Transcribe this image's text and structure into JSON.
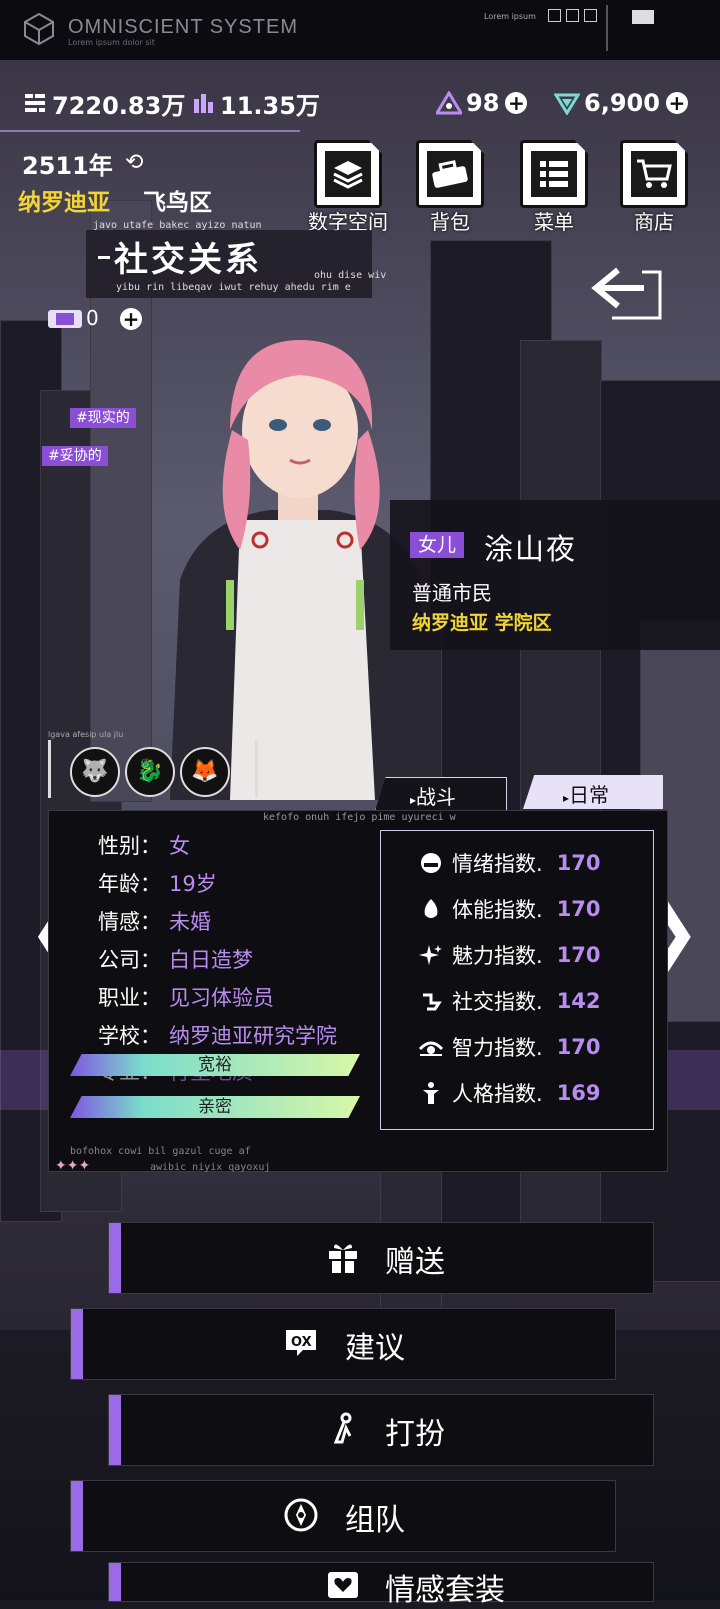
{
  "topbar": {
    "title": "OMNISCIENT SYSTEM",
    "subtitle": "Lorem ipsum dolor sit",
    "lorem": "Lorem ipsum"
  },
  "resources": {
    "money": "7220.83万",
    "gem_purple": "11.35万",
    "energy": "98",
    "crystal": "6,900"
  },
  "location": {
    "year": "2511年",
    "city": "纳罗迪亚",
    "district": "飞鸟区"
  },
  "nav": {
    "digital_space": "数字空间",
    "bag": "背包",
    "menu": "菜单",
    "shop": "商店"
  },
  "section": {
    "title": "社交关系",
    "small1": "javo utafe bakec ayizo natun",
    "small2": "yibu rin libeqav iwut rehuy ahedu rim e",
    "small3": "ohu dise wiv"
  },
  "ticket_count": "0",
  "tags": [
    "#现实的",
    "#妥协的"
  ],
  "character": {
    "relation": "女儿",
    "name": "涂山夜",
    "role": "普通市民",
    "location": "纳罗迪亚 学院区"
  },
  "emblem_caption": "lgava afesip ula jlu",
  "tabs": {
    "fight": "战斗",
    "daily": "日常"
  },
  "panel": {
    "small": "kefofo onuh ifejo pime uyureci w",
    "foot1": "bofohox cowi bil gazul cuge af",
    "foot2": "awibic niyix qayoxuj",
    "stars": "✦✦✦"
  },
  "info": [
    {
      "label": "性别：",
      "value": "女"
    },
    {
      "label": "年龄：",
      "value": "19岁"
    },
    {
      "label": "情感：",
      "value": "未婚"
    },
    {
      "label": "公司：",
      "value": "白日造梦"
    },
    {
      "label": "职业：",
      "value": "见习体验员"
    },
    {
      "label": "学校：",
      "value": "纳罗迪亚研究学院"
    },
    {
      "label": "专业：",
      "value": "行星地质"
    }
  ],
  "stats": [
    {
      "label": "情绪指数.",
      "value": "170",
      "icon": "mood-icon"
    },
    {
      "label": "体能指数.",
      "value": "170",
      "icon": "fitness-icon"
    },
    {
      "label": "魅力指数.",
      "value": "170",
      "icon": "charm-icon"
    },
    {
      "label": "社交指数.",
      "value": "142",
      "icon": "social-icon"
    },
    {
      "label": "智力指数.",
      "value": "170",
      "icon": "intellect-icon"
    },
    {
      "label": "人格指数.",
      "value": "169",
      "icon": "personality-icon"
    }
  ],
  "traits": [
    "宽裕",
    "亲密"
  ],
  "actions": {
    "gift": "赠送",
    "suggest": "建议",
    "dress": "打扮",
    "team": "组队",
    "emotion": "情感套装"
  },
  "colors": {
    "accent": "#9b6ae8",
    "highlight": "#f2d433",
    "value": "#b98cf0"
  }
}
